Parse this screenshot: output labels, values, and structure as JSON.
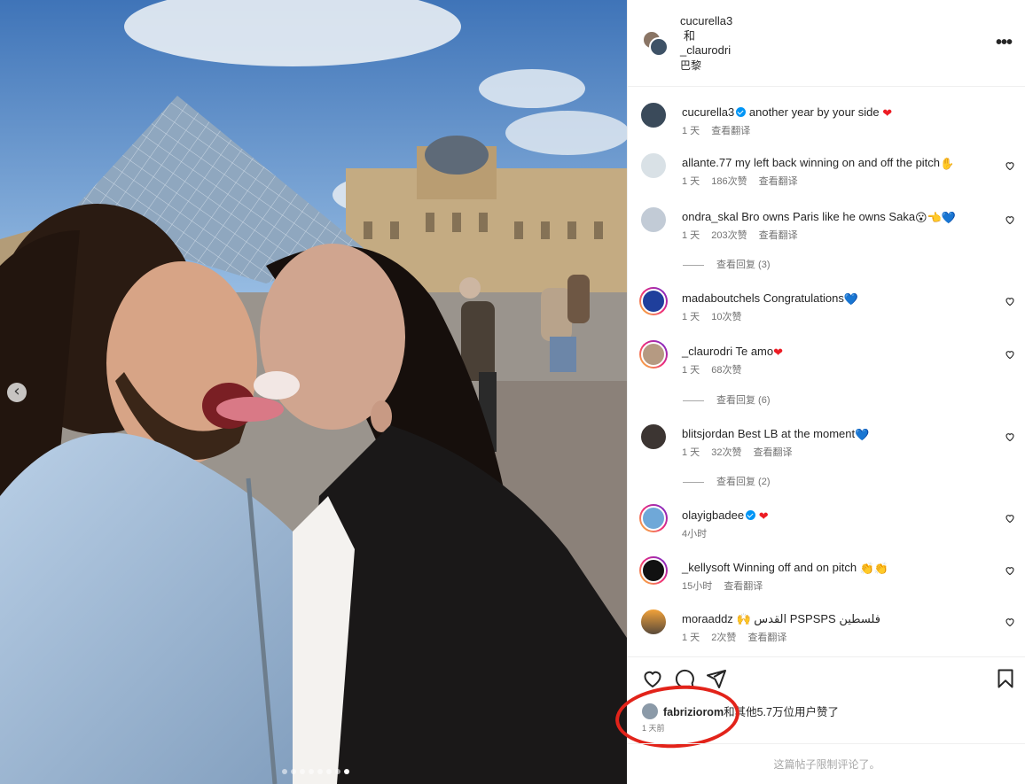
{
  "header": {
    "author1": "cucurella3",
    "joiner": "和",
    "author2": "_claurodri",
    "location": "巴黎"
  },
  "caption": {
    "user": "cucurella3",
    "text": "another year by your side",
    "time": "1 天",
    "translate": "查看翻译"
  },
  "comments": [
    {
      "user": "allante.77",
      "text": "my left back winning on and off the pitch",
      "emoji": "✋",
      "time": "1 天",
      "likes": "186次赞",
      "translate": "查看翻译"
    },
    {
      "user": "ondra_skal",
      "text": "Bro owns Paris like he owns Saka",
      "emoji": "😮👈💙",
      "time": "1 天",
      "likes": "203次赞",
      "translate": "查看翻译",
      "replies": "查看回复 (3)"
    },
    {
      "user": "madaboutchels",
      "text": "Congratulations",
      "emoji": "💙",
      "time": "1 天",
      "likes": "10次赞",
      "translate": ""
    },
    {
      "user": "_claurodri",
      "text": "Te amo",
      "emoji": "❤",
      "time": "1 天",
      "likes": "68次赞",
      "translate": "",
      "replies": "查看回复 (6)"
    },
    {
      "user": "blitsjordan",
      "text": "Best LB at the moment",
      "emoji": "💙",
      "time": "1 天",
      "likes": "32次赞",
      "translate": "查看翻译",
      "replies": "查看回复 (2)"
    },
    {
      "user": "olayigbadee",
      "text": "",
      "emoji": "❤",
      "time": "4小时",
      "likes": "",
      "translate": ""
    },
    {
      "user": "_kellysoft",
      "text": "Winning off and on pitch",
      "emoji": "👏👏",
      "time": "15小时",
      "likes": "",
      "translate": "查看翻译"
    },
    {
      "user": "moraaddz",
      "text": "🙌 القدس PSPSPS فلسطين",
      "emoji": "",
      "time": "1 天",
      "likes": "2次赞",
      "translate": "查看翻译"
    }
  ],
  "likes": {
    "user": "fabriziorom",
    "rest": "和其他5.7万位用户赞了",
    "time": "1 天前"
  },
  "footer": {
    "restricted": "这篇帖子限制评论了。"
  },
  "colors": {
    "accent_blue": "#0095f6",
    "annotation_red": "#e2231a",
    "like_heart": "#ed4956"
  },
  "carousel": {
    "total": 8,
    "active_index": 7
  }
}
